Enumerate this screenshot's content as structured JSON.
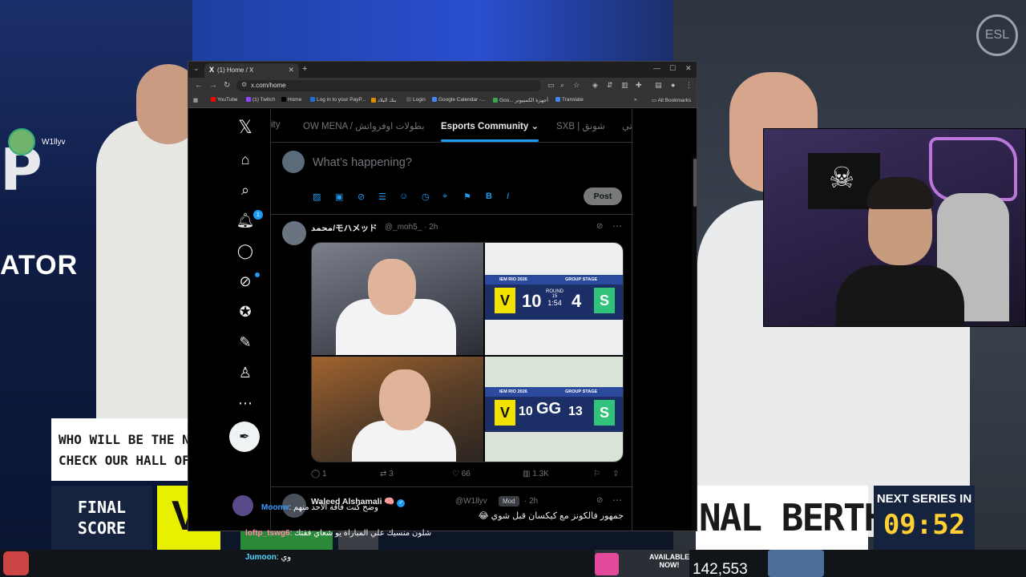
{
  "stream": {
    "top_avatar_name": "W1llyv",
    "predator_mark": "P",
    "predator_text": "ATOR",
    "esl_icon": "ESL",
    "overlay_who_line1": "WHO WILL BE THE NEX",
    "overlay_who_line2": "CHECK OUR HALL OF F",
    "final_score_line1": "FINAL",
    "final_score_line2": "SCORE",
    "yellow_mark": "V",
    "berth_text": "NAL BERTH",
    "next_series_label": "NEXT SERIES IN",
    "next_series_time": "09:52",
    "available_text_1": "AVAILABLE",
    "available_text_2": "NOW!",
    "viewer_count": "142,553",
    "cam_flag_icon": "☠",
    "chat": [
      {
        "name": "Moonw",
        "text": ": وضح كنت فاقة الأحد منهم"
      },
      {
        "name": "loftp_tswg6",
        "text": ": شلون منسيك علي المباراة يو شعاي فقتك"
      },
      {
        "name": "Jumoon",
        "text": ": وي"
      }
    ]
  },
  "browser": {
    "tab_title": "(1) Home / X",
    "url": "x.com/home",
    "bookmarks": [
      {
        "label": "YouTube",
        "color": "#ff0000"
      },
      {
        "label": "(1) Twitch",
        "color": "#9146ff"
      },
      {
        "label": "Home",
        "color": "#000000"
      },
      {
        "label": "Log in to your PayP...",
        "color": "#1d6fd6"
      },
      {
        "label": "بنك البلاد",
        "color": "#e08a00"
      },
      {
        "label": "Login",
        "color": "#555555"
      },
      {
        "label": "Google Calendar -...",
        "color": "#4285f4"
      },
      {
        "label": "Goo... أجهزة الكمبيوتر",
        "color": "#34a853"
      },
      {
        "label": "Translate",
        "color": "#4285f4"
      }
    ],
    "all_bookmarks": "All Bookmarks"
  },
  "x": {
    "logo": "𝕏",
    "notification_count": "1",
    "tabs": {
      "t0": "ity",
      "t1": "OW MENA / بطولات اوفرواتش",
      "t2": "Esports Community",
      "t3": "SXB | شونق",
      "t4": "تي"
    },
    "composer_placeholder": "What’s happening?",
    "post_label": "Post",
    "tweet": {
      "name": "محمد/モハメッド",
      "handle": "@_moh5_ · 2h",
      "replies": "1",
      "reposts": "3",
      "likes": "66",
      "views": "1.3K",
      "board1": {
        "event": "IEM RIO 2026",
        "stage": "GROUP STAGE",
        "left": "10",
        "right": "4",
        "round": "ROUND 15",
        "clock": "1:54",
        "left_team": "V",
        "right_team": "S"
      },
      "board2": {
        "event": "IEM RIO 2026",
        "stage": "GROUP STAGE",
        "left": "10",
        "mid": "GG",
        "right": "13",
        "left_team": "V",
        "right_team": "S"
      }
    },
    "tweet2": {
      "name": "Waleed Alshamali 🧠",
      "handle": "@W1llyv",
      "badge": "Mod",
      "time": "· 2h",
      "text": "جمهور فالكونز مع كيكسان قبل شوي 😂"
    }
  }
}
